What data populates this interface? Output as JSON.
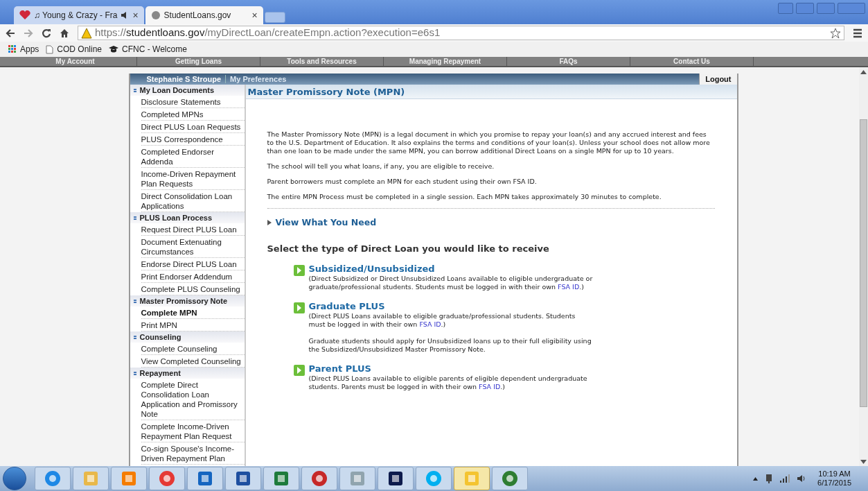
{
  "browser": {
    "tabs": [
      {
        "title": "♫ Young & Crazy - Fra",
        "selected": false,
        "audio": true,
        "close": "×"
      },
      {
        "title": "StudentLoans.gov",
        "selected": true,
        "audio": false,
        "close": "×"
      }
    ],
    "url": {
      "scheme": "https://",
      "host": "studentloans.gov",
      "path": "/myDirectLoan/createEmpn.action?execution=e6s1"
    },
    "bookmarks": [
      {
        "kind": "apps",
        "label": "Apps"
      },
      {
        "kind": "page",
        "label": "COD Online"
      },
      {
        "kind": "cap",
        "label": "CFNC - Welcome"
      }
    ]
  },
  "site_nav": [
    "My Account",
    "Getting Loans",
    "Tools and Resources",
    "Managing Repayment",
    "FAQs",
    "Contact Us"
  ],
  "user_bar": {
    "name": "Stephanie S Stroupe",
    "preferences": "My Preferences",
    "logout": "Logout"
  },
  "sidebar": {
    "sections": [
      {
        "title": "My Loan Documents",
        "items": [
          {
            "label": "Disclosure Statements",
            "selected": false
          },
          {
            "label": "Completed MPNs",
            "selected": false
          },
          {
            "label": "Direct PLUS Loan Requests",
            "selected": false
          },
          {
            "label": "PLUS Correspondence",
            "selected": false
          },
          {
            "label": "Completed Endorser Addenda",
            "selected": false
          },
          {
            "label": "Income-Driven Repayment Plan Requests",
            "selected": false
          },
          {
            "label": "Direct Consolidation Loan Applications",
            "selected": false
          }
        ]
      },
      {
        "title": "PLUS Loan Process",
        "items": [
          {
            "label": "Request Direct PLUS Loan",
            "selected": false
          },
          {
            "label": "Document Extenuating Circumstances",
            "selected": false
          },
          {
            "label": "Endorse Direct PLUS Loan",
            "selected": false
          },
          {
            "label": "Print Endorser Addendum",
            "selected": false
          },
          {
            "label": "Complete PLUS Counseling",
            "selected": false
          }
        ]
      },
      {
        "title": "Master Promissory Note",
        "items": [
          {
            "label": "Complete MPN",
            "selected": true
          },
          {
            "label": "Print MPN",
            "selected": false
          }
        ]
      },
      {
        "title": "Counseling",
        "items": [
          {
            "label": "Complete Counseling",
            "selected": false
          },
          {
            "label": "View Completed Counseling",
            "selected": false
          }
        ]
      },
      {
        "title": "Repayment",
        "items": [
          {
            "label": "Complete Direct Consolidation Loan Application and Promissory Note",
            "selected": false
          },
          {
            "label": "Complete Income-Driven Repayment Plan Request",
            "selected": false
          },
          {
            "label": "Co-sign Spouse's Income-Driven Repayment Plan",
            "selected": false
          }
        ]
      }
    ]
  },
  "main": {
    "title": "Master Promissory Note (MPN)",
    "paragraphs": [
      "The Master Promissory Note (MPN) is a legal document in which you promise to repay your loan(s) and any accrued interest and fees to the U.S. Department of Education. It also explains the terms and conditions of your loan(s). Unless your school does not allow more than one loan to be made under the same MPN, you can borrow additional Direct Loans on a single MPN for up to 10 years.",
      "The school will tell you what loans, if any, you are eligible to receive.",
      "Parent borrowers must complete an MPN for each student using their own FSA ID.",
      "The entire MPN Process must be completed in a single session. Each MPN takes approximately 30 minutes to complete."
    ],
    "expander": {
      "label": "View What You Need",
      "expanded": false
    },
    "select_heading": "Select the type of Direct Loan you would like to receive",
    "options": [
      {
        "title": "Subsidized/Unsubsidized",
        "description": "(Direct Subsidized or Direct Unsubsidized Loans available to eligible undergraduate or graduate/professional students. Students must be logged in with their own",
        "link": "FSA ID",
        "after": ".)"
      },
      {
        "title": "Graduate PLUS",
        "description": "(Direct PLUS Loans available to eligible graduate/professional students. Students must be logged in with their own",
        "link": "FSA ID",
        "after": ".)",
        "note": "Graduate students should apply for Unsubsidized loans up to their full eligibility using the Subsidized/Unsubsidized Master Promissory Note."
      },
      {
        "title": "Parent PLUS",
        "description": "(Direct PLUS Loans available to eligible parents of eligible dependent undergraduate students. Parents must be logged in with their own",
        "link": "FSA ID",
        "after": ".)"
      }
    ]
  },
  "taskbar": {
    "apps": [
      {
        "kind": "ie",
        "selected": false
      },
      {
        "kind": "folder",
        "selected": false
      },
      {
        "kind": "media",
        "selected": false
      },
      {
        "kind": "chrome",
        "selected": false
      },
      {
        "kind": "outlook",
        "selected": false
      },
      {
        "kind": "word",
        "selected": false
      },
      {
        "kind": "excel",
        "selected": false
      },
      {
        "kind": "swirl",
        "selected": false
      },
      {
        "kind": "calculator",
        "selected": false
      },
      {
        "kind": "journal",
        "selected": false
      },
      {
        "kind": "skype",
        "selected": false
      },
      {
        "kind": "shield",
        "selected": true
      },
      {
        "kind": "spiral",
        "selected": false
      }
    ],
    "time": "10:19 AM",
    "date": "6/17/2015"
  }
}
